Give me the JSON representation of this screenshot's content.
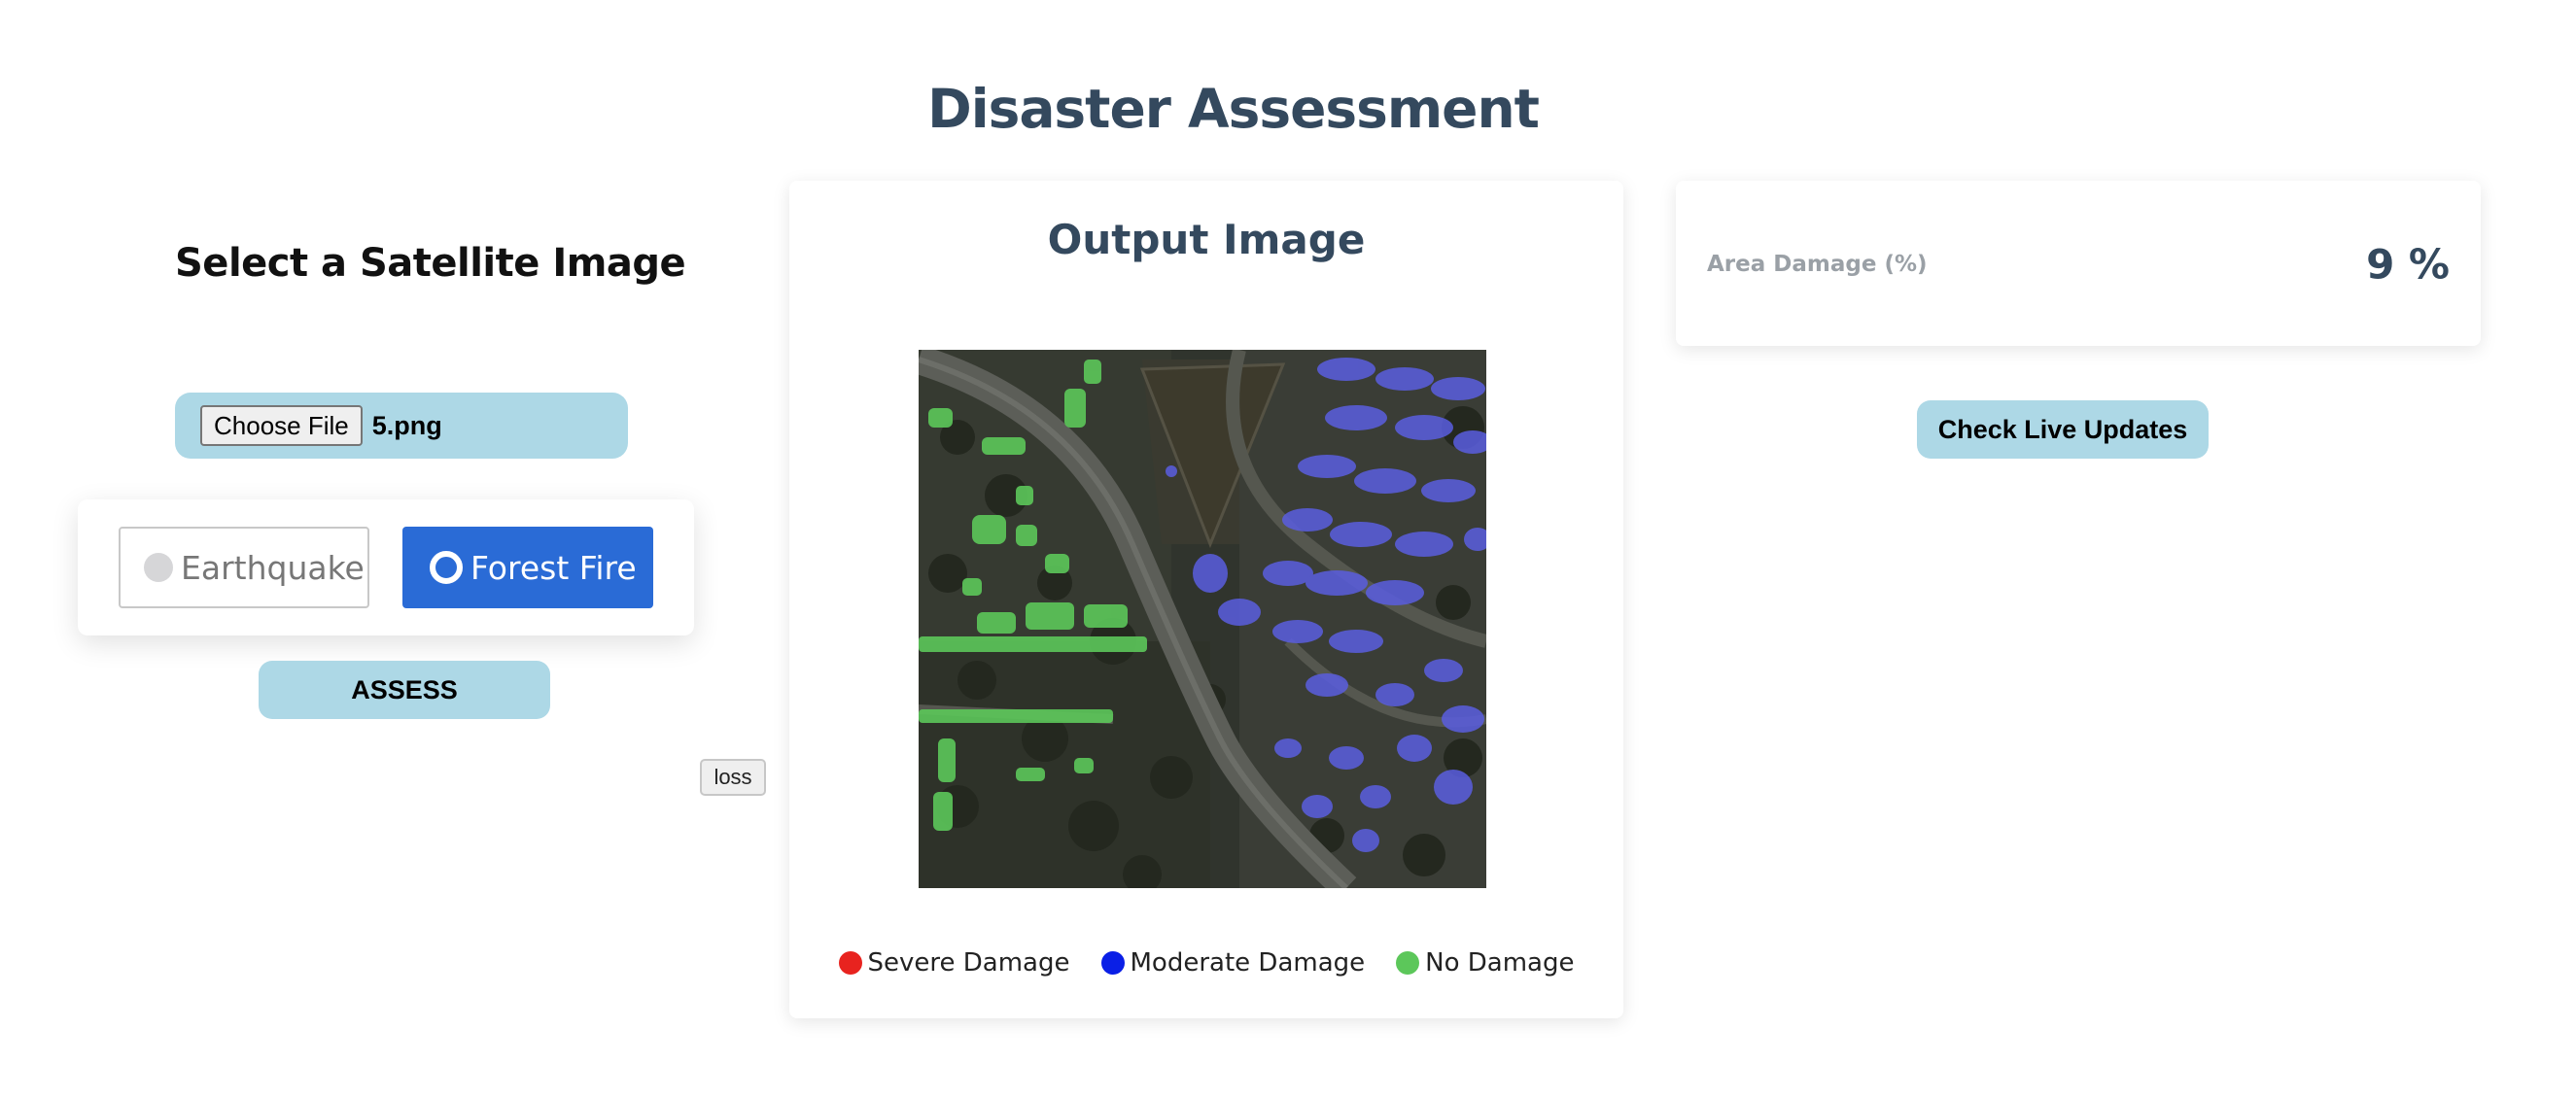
{
  "page": {
    "title": "Disaster Assessment"
  },
  "upload": {
    "heading": "Select a Satellite Image",
    "choose_label": "Choose File",
    "file_name": "5.png"
  },
  "disaster_type": {
    "options": [
      {
        "label": "Earthquake",
        "selected": false
      },
      {
        "label": "Forest Fire",
        "selected": true
      }
    ],
    "selected_color": "#2a6bd6"
  },
  "actions": {
    "assess_label": "ASSESS",
    "loss_label": "loss",
    "live_updates_label": "Check Live Updates",
    "button_color": "#add8e6"
  },
  "output": {
    "title": "Output Image",
    "legend": [
      {
        "label": "Severe Damage",
        "color": "#e8231f"
      },
      {
        "label": "Moderate Damage",
        "color": "#0a1fe6"
      },
      {
        "label": "No Damage",
        "color": "#5cc75a"
      }
    ]
  },
  "damage": {
    "label": "Area Damage (%)",
    "value": "9 %"
  }
}
